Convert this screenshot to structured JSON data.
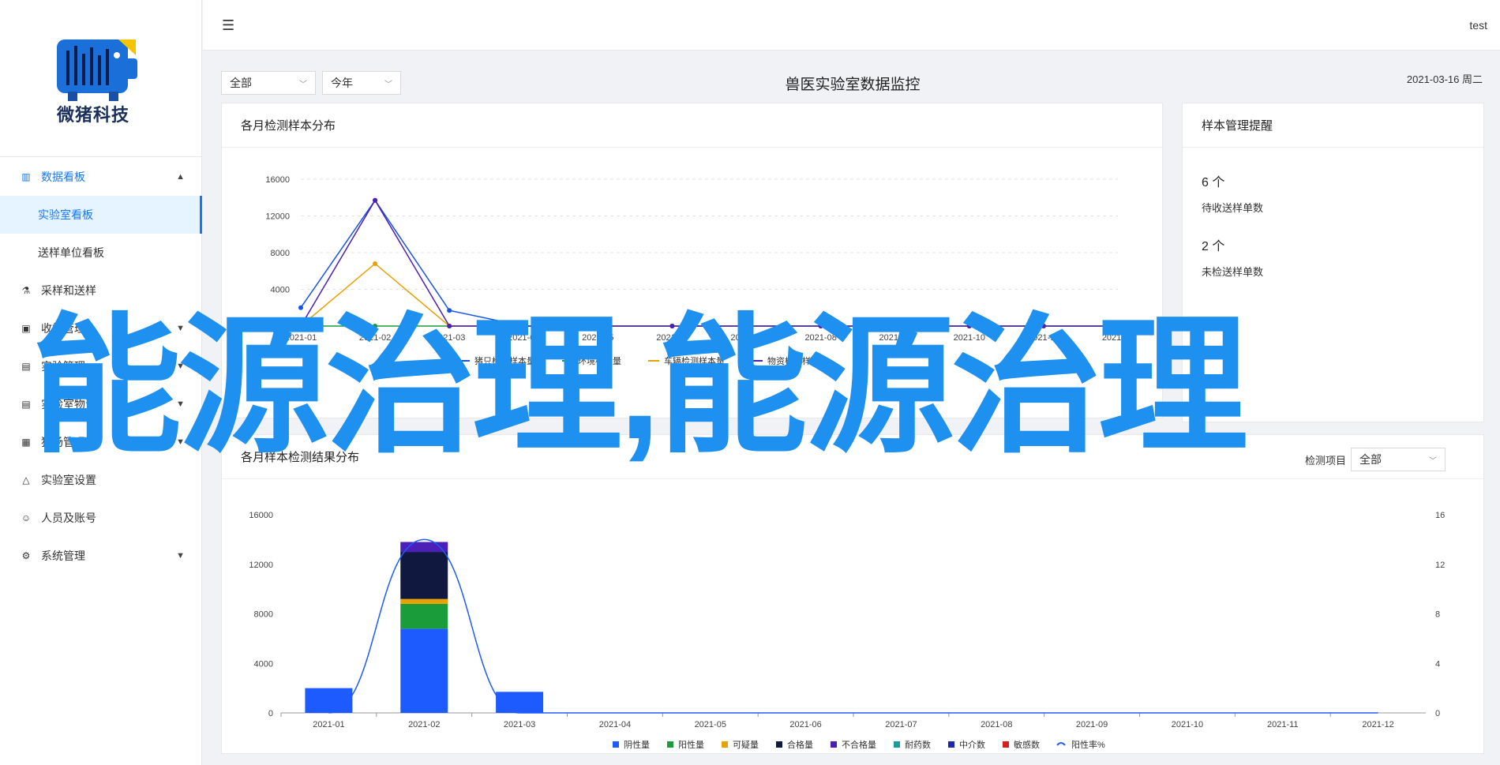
{
  "brand": {
    "name": "微猪科技",
    "logo_icon": "barcode-pig-logo"
  },
  "topbar": {
    "user": "test"
  },
  "sidebar": {
    "items": [
      {
        "label": "数据看板",
        "icon": "bar-chart-icon",
        "open": true
      },
      {
        "label": "实验室看板",
        "active": true
      },
      {
        "label": "送样单位看板"
      },
      {
        "label": "采样和送样",
        "icon": "flask-icon"
      },
      {
        "label": "收样管理",
        "icon": "box-icon",
        "expandable": true
      },
      {
        "label": "实验管理",
        "icon": "file-icon",
        "expandable": true
      },
      {
        "label": "实验室物资",
        "icon": "doc-icon",
        "expandable": true
      },
      {
        "label": "猪场管理",
        "icon": "farm-icon",
        "expandable": true
      },
      {
        "label": "实验室设置",
        "icon": "beaker-icon"
      },
      {
        "label": "人员及账号",
        "icon": "user-icon"
      },
      {
        "label": "系统管理",
        "icon": "gear-icon",
        "expandable": true
      }
    ]
  },
  "filters": {
    "scope": "全部",
    "period": "今年"
  },
  "page": {
    "title": "兽医实验室数据监控",
    "date": "2021-03-16 周二"
  },
  "card1": {
    "title": "各月检测样本分布"
  },
  "card2": {
    "title": "样本管理提醒",
    "count1": "6 个",
    "label1": "待收送样单数",
    "count2": "2 个",
    "label2": "未检送样单数"
  },
  "card3": {
    "title": "各月样本检测结果分布",
    "filter_label": "检测项目",
    "filter_value": "全部"
  },
  "watermark": "能源治理,能源治理",
  "colors": {
    "accent": "#1677ff",
    "watermark": "#1e90f0"
  },
  "chart_data": [
    {
      "type": "line",
      "x": [
        "2021-01",
        "2021-02",
        "2021-03",
        "2021-04",
        "2021-05",
        "2021-06",
        "2021-07",
        "2021-08",
        "2021-09",
        "2021-10",
        "2021-11",
        "2021-12"
      ],
      "ylim": [
        0,
        16000
      ],
      "yticks": [
        0,
        4000,
        8000,
        12000,
        16000
      ],
      "grid": true,
      "legend_position": "bottom",
      "series": [
        {
          "name": "猪只检测样本量",
          "color": "#1553e8",
          "values": [
            2000,
            13700,
            1700,
            0,
            0,
            0,
            0,
            0,
            0,
            0,
            0,
            0
          ]
        },
        {
          "name": "环境样本量",
          "color": "#1a9c3a",
          "values": [
            0,
            0,
            0,
            0,
            0,
            0,
            0,
            0,
            0,
            0,
            0,
            0
          ]
        },
        {
          "name": "车辆检测样本量",
          "color": "#e8a200",
          "values": [
            0,
            6800,
            0,
            0,
            0,
            0,
            0,
            0,
            0,
            0,
            0,
            0
          ]
        },
        {
          "name": "物资检测样本量",
          "color": "#4b1fb8",
          "values": [
            0,
            13700,
            0,
            0,
            0,
            0,
            0,
            0,
            0,
            0,
            0,
            0
          ]
        }
      ]
    },
    {
      "type": "bar",
      "categories": [
        "2021-01",
        "2021-02",
        "2021-03",
        "2021-04",
        "2021-05",
        "2021-06",
        "2021-07",
        "2021-08",
        "2021-09",
        "2021-10",
        "2021-11",
        "2021-12"
      ],
      "ylim": [
        0,
        16000
      ],
      "yticks": [
        0,
        4000,
        8000,
        12000,
        16000
      ],
      "y2lim": [
        0,
        16
      ],
      "y2ticks": [
        0,
        4,
        8,
        12,
        16
      ],
      "stacked": true,
      "legend_position": "bottom",
      "series": [
        {
          "name": "阴性量",
          "color": "#1e5bff",
          "values": [
            2000,
            6800,
            1700,
            0,
            0,
            0,
            0,
            0,
            0,
            0,
            0,
            0
          ]
        },
        {
          "name": "阳性量",
          "color": "#1a9c3a",
          "values": [
            0,
            2000,
            0,
            0,
            0,
            0,
            0,
            0,
            0,
            0,
            0,
            0
          ]
        },
        {
          "name": "可疑量",
          "color": "#e8a200",
          "values": [
            0,
            400,
            0,
            0,
            0,
            0,
            0,
            0,
            0,
            0,
            0,
            0
          ]
        },
        {
          "name": "合格量",
          "color": "#101840",
          "values": [
            0,
            3800,
            0,
            0,
            0,
            0,
            0,
            0,
            0,
            0,
            0,
            0
          ]
        },
        {
          "name": "不合格量",
          "color": "#4b1fb8",
          "values": [
            0,
            800,
            0,
            0,
            0,
            0,
            0,
            0,
            0,
            0,
            0,
            0
          ]
        },
        {
          "name": "耐药数",
          "color": "#1a9c9c",
          "values": [
            0,
            0,
            0,
            0,
            0,
            0,
            0,
            0,
            0,
            0,
            0,
            0
          ]
        },
        {
          "name": "中介数",
          "color": "#1a2aa8",
          "values": [
            0,
            0,
            0,
            0,
            0,
            0,
            0,
            0,
            0,
            0,
            0,
            0
          ]
        },
        {
          "name": "敏感数",
          "color": "#d62020",
          "values": [
            0,
            0,
            0,
            0,
            0,
            0,
            0,
            0,
            0,
            0,
            0,
            0
          ]
        }
      ],
      "line_series": {
        "name": "阳性率%",
        "color": "#1e5bff",
        "axis": "right",
        "values": [
          0,
          14,
          0,
          0,
          0,
          0,
          0,
          0,
          0,
          0,
          0,
          0
        ]
      }
    }
  ]
}
